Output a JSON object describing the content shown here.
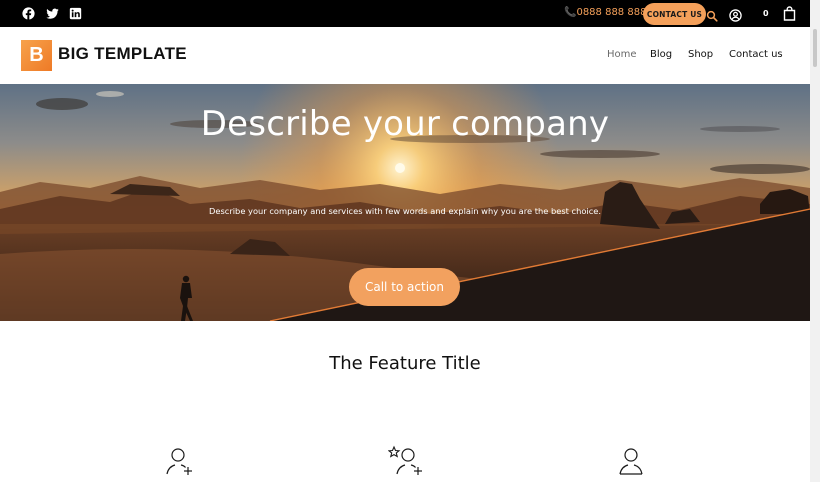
{
  "topbar": {
    "social": [
      "facebook-icon",
      "twitter-icon",
      "linkedin-icon"
    ],
    "phone": "📞0888 888 888",
    "contact_button": "CONTACT US",
    "cart_count": "0",
    "icons": [
      "search-icon",
      "account-icon",
      "cart-icon"
    ]
  },
  "header": {
    "logo_letter": "B",
    "logo_text": "BIG TEMPLATE",
    "nav": [
      "Home",
      "Blog",
      "Shop",
      "Contact us"
    ],
    "active_nav": "Home"
  },
  "hero": {
    "title": "Describe your company",
    "subtitle": "Describe your company and services with few words and explain why you are the best choice.",
    "cta": "Call to action"
  },
  "features": {
    "title": "The Feature Title",
    "icons": [
      "add-user-icon",
      "favorite-user-icon",
      "user-icon"
    ]
  },
  "colors": {
    "accent": "#f4a05a",
    "topbar": "#000000",
    "logo": "#ee7a26"
  }
}
